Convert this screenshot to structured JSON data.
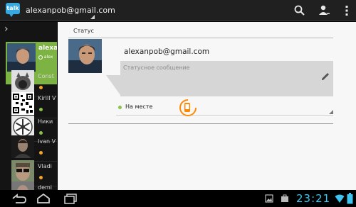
{
  "app": {
    "icon_label": "talk",
    "account_email": "alexanpob@gmail.com"
  },
  "colors": {
    "accent_green": "#7cb342",
    "presence_available": "#8bc34a",
    "presence_away": "#f5a623",
    "clock_blue": "#3ec4ef",
    "holo_orange": "#ff8a00"
  },
  "actionbar": {
    "icons": [
      "search-icon",
      "add-person-icon",
      "overflow-menu-icon"
    ]
  },
  "sidebar": {
    "selected": {
      "name": "alexa",
      "status_text": "alex"
    },
    "contacts": [
      {
        "name": "Const",
        "status": "away",
        "avatar": "wolf-avatar"
      },
      {
        "name": "Kirill V",
        "status": "available",
        "avatar": "qr-avatar"
      },
      {
        "name": "Ники",
        "status": "available",
        "avatar": "snowflake-avatar"
      },
      {
        "name": "Ivan V",
        "status": "away",
        "avatar": "portrait-avatar"
      },
      {
        "name": "Vladi",
        "status": "away",
        "avatar": "sunglasses-avatar"
      },
      {
        "name": "demi",
        "status": "available",
        "avatar": "person-avatar"
      }
    ]
  },
  "profile": {
    "section_title": "Статус",
    "email": "alexanpob@gmail.com",
    "status_placeholder": "Статусное сообщение",
    "presence_label": "На месте"
  },
  "systembar": {
    "clock": "23:21"
  }
}
